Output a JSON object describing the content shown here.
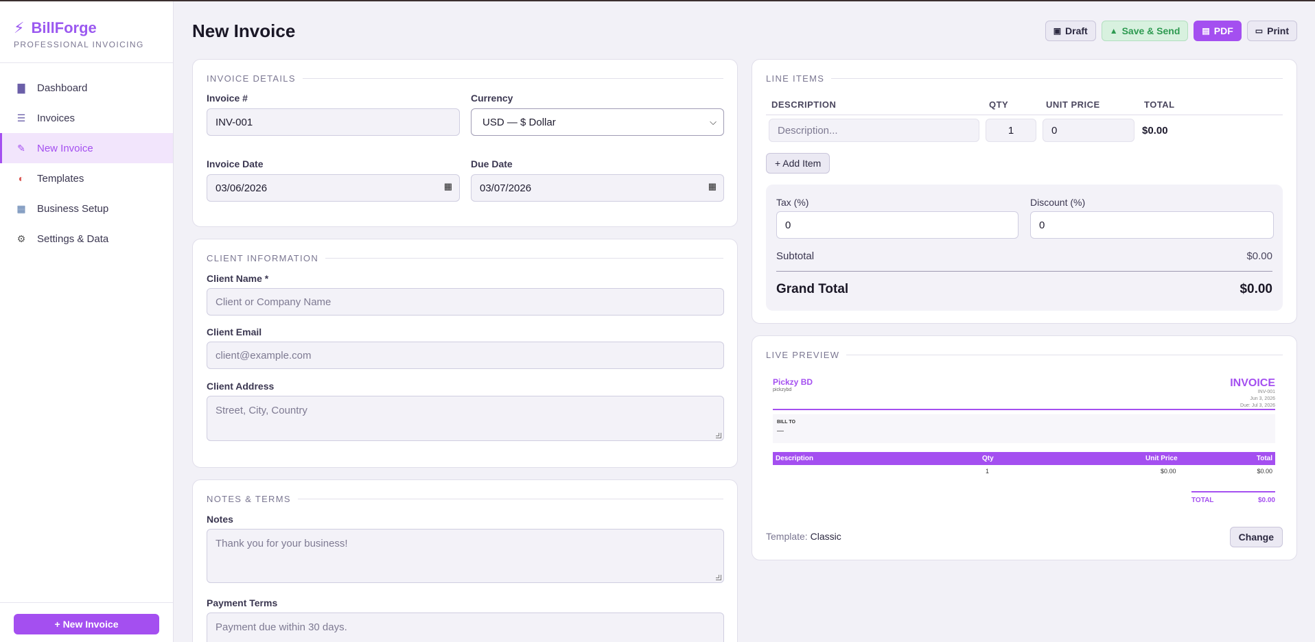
{
  "brand": {
    "name": "BillForge",
    "subtitle": "PROFESSIONAL INVOICING"
  },
  "sidebar": {
    "items": [
      {
        "label": "Dashboard",
        "icon": "bar-chart-icon"
      },
      {
        "label": "Invoices",
        "icon": "document-icon"
      },
      {
        "label": "New Invoice",
        "icon": "pencil-icon",
        "active": true
      },
      {
        "label": "Templates",
        "icon": "palette-icon"
      },
      {
        "label": "Business Setup",
        "icon": "building-icon"
      },
      {
        "label": "Settings & Data",
        "icon": "gear-icon"
      }
    ],
    "new_invoice_button": "+ New Invoice"
  },
  "header": {
    "title": "New Invoice",
    "actions": {
      "draft": "Draft",
      "save_send": "Save & Send",
      "pdf": "PDF",
      "print": "Print"
    }
  },
  "invoice_details": {
    "section": "INVOICE DETAILS",
    "number_label": "Invoice #",
    "number_value": "INV-001",
    "currency_label": "Currency",
    "currency_value": "USD — $ Dollar",
    "date_label": "Invoice Date",
    "date_value": "03/06/2026",
    "due_label": "Due Date",
    "due_value": "03/07/2026"
  },
  "client": {
    "section": "CLIENT INFORMATION",
    "name_label": "Client Name *",
    "name_placeholder": "Client or Company Name",
    "email_label": "Client Email",
    "email_placeholder": "client@example.com",
    "address_label": "Client Address",
    "address_placeholder": "Street, City, Country"
  },
  "notes": {
    "section": "NOTES & TERMS",
    "notes_label": "Notes",
    "notes_value": "Thank you for your business!",
    "terms_label": "Payment Terms",
    "terms_value": "Payment due within 30 days."
  },
  "line_items": {
    "section": "LINE ITEMS",
    "columns": [
      "DESCRIPTION",
      "QTY",
      "UNIT PRICE",
      "TOTAL"
    ],
    "row": {
      "description_placeholder": "Description...",
      "qty": "1",
      "unit_price": "0",
      "total": "$0.00"
    },
    "add_item": "+ Add Item",
    "tax_label": "Tax (%)",
    "tax_value": "0",
    "discount_label": "Discount (%)",
    "discount_value": "0",
    "subtotal_label": "Subtotal",
    "subtotal_value": "$0.00",
    "grand_total_label": "Grand Total",
    "grand_total_value": "$0.00"
  },
  "live_preview": {
    "section": "LIVE PREVIEW",
    "business_name": "Pickzy BD",
    "business_sub": "pickzybd",
    "doc_title": "INVOICE",
    "doc_number": "INV-001",
    "doc_date": "Jun 3, 2026",
    "doc_due": "Due: Jul 3, 2026",
    "bill_to_label": "BILL TO",
    "bill_to_value": "—",
    "columns": [
      "Description",
      "Qty",
      "Unit Price",
      "Total"
    ],
    "row": {
      "qty": "1",
      "unit_price": "$0.00",
      "total": "$0.00"
    },
    "total_label": "TOTAL",
    "total_value": "$0.00",
    "template_label": "Template:",
    "template_value": "Classic",
    "change_button": "Change"
  },
  "colors": {
    "accent": "#a44ff0",
    "success": "#2e9a51",
    "background": "#f2f1f7"
  }
}
